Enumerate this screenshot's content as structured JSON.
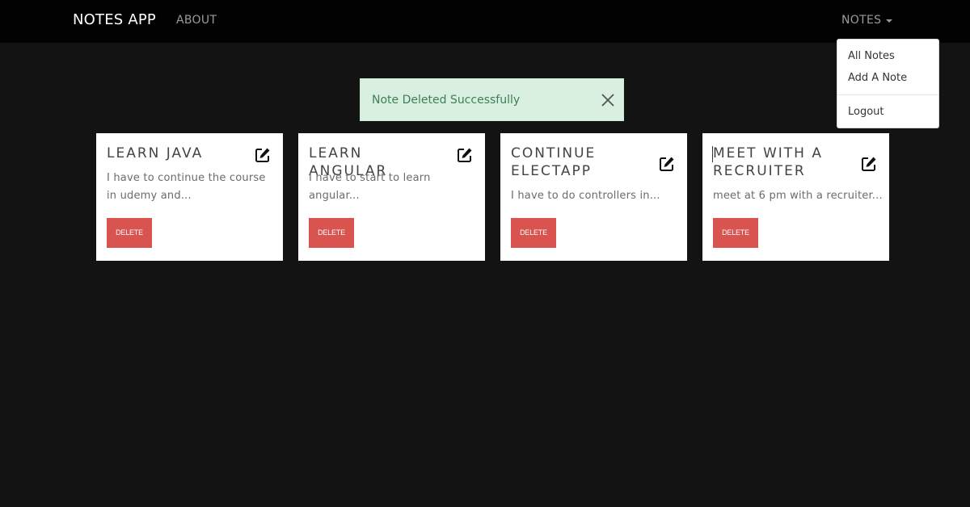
{
  "navbar": {
    "brand": "NOTES APP",
    "about": "ABOUT",
    "notes": "NOTES"
  },
  "dropdown": {
    "items": [
      "All Notes",
      "Add A Note",
      "Logout"
    ]
  },
  "alert": {
    "message": "Note Deleted Successfully"
  },
  "notes": [
    {
      "title": "LEARN JAVA",
      "description": "I have to continue the course in udemy and...",
      "delete_label": "DELETE"
    },
    {
      "title": "LEARN ANGULAR",
      "description": "I have to start to learn angular...",
      "delete_label": "DELETE"
    },
    {
      "title": "CONTINUE ELECTAPP",
      "description": "I have to do controllers in...",
      "delete_label": "DELETE"
    },
    {
      "title": "MEET WITH A RECRUITER",
      "description": "meet at 6 pm with a recruiter...",
      "delete_label": "DELETE"
    }
  ],
  "colors": {
    "navbar_bg": "#020202",
    "page_bg": "#131313",
    "alert_bg": "#d9efdf",
    "alert_text": "#3d7f56",
    "delete_button": "#d9534f"
  },
  "icons": {
    "edit": "edit-icon",
    "close": "close-icon",
    "caret": "caret-down-icon"
  }
}
